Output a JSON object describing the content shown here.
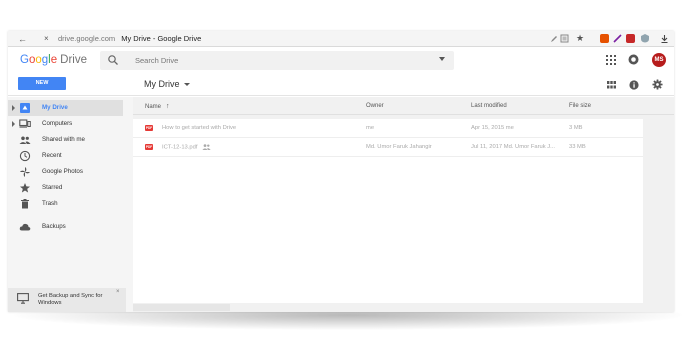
{
  "browser": {
    "url": "drive.google.com",
    "tab_title": "My Drive - Google Drive"
  },
  "header": {
    "logo_letters": [
      "G",
      "o",
      "o",
      "g",
      "l",
      "e"
    ],
    "product": "Drive",
    "search_placeholder": "Search Drive",
    "avatar_initials": "MS"
  },
  "toolbar": {
    "new_label": "NEW",
    "title": "My Drive"
  },
  "sidebar": {
    "items": [
      {
        "label": "My Drive",
        "icon": "drive-icon",
        "expandable": true,
        "active": true
      },
      {
        "label": "Computers",
        "icon": "computer-icon",
        "expandable": true,
        "active": false
      },
      {
        "label": "Shared with me",
        "icon": "people-icon",
        "expandable": false,
        "active": false
      },
      {
        "label": "Recent",
        "icon": "clock-icon",
        "expandable": false,
        "active": false
      },
      {
        "label": "Google Photos",
        "icon": "pinwheel-icon",
        "expandable": false,
        "active": false
      },
      {
        "label": "Starred",
        "icon": "star-icon",
        "expandable": false,
        "active": false
      },
      {
        "label": "Trash",
        "icon": "trash-icon",
        "expandable": false,
        "active": false
      },
      {
        "label": "Backups",
        "icon": "cloud-icon",
        "expandable": false,
        "active": false
      }
    ],
    "backup_promo": "Get Backup and Sync for Windows",
    "backup_close": "×"
  },
  "list": {
    "columns": {
      "name": "Name",
      "owner": "Owner",
      "last_modified": "Last modified",
      "file_size": "File size"
    },
    "files": [
      {
        "type": "PDF",
        "name": "How to get started with Drive",
        "shared": false,
        "owner": "me",
        "modified": "Apr 15, 2015 me",
        "size": "3 MB"
      },
      {
        "type": "PDF",
        "name": "ICT-12-13.pdf",
        "shared": true,
        "owner": "Md. Umor Faruk Jahangir",
        "modified": "Jul 11, 2017 Md. Umor Faruk J...",
        "size": "33 MB"
      }
    ]
  },
  "colors": {
    "accent": "#4285f4",
    "pdf_red": "#e53935",
    "avatar": "#b71c1c",
    "sidebar_bg": "#f5f5f5"
  }
}
